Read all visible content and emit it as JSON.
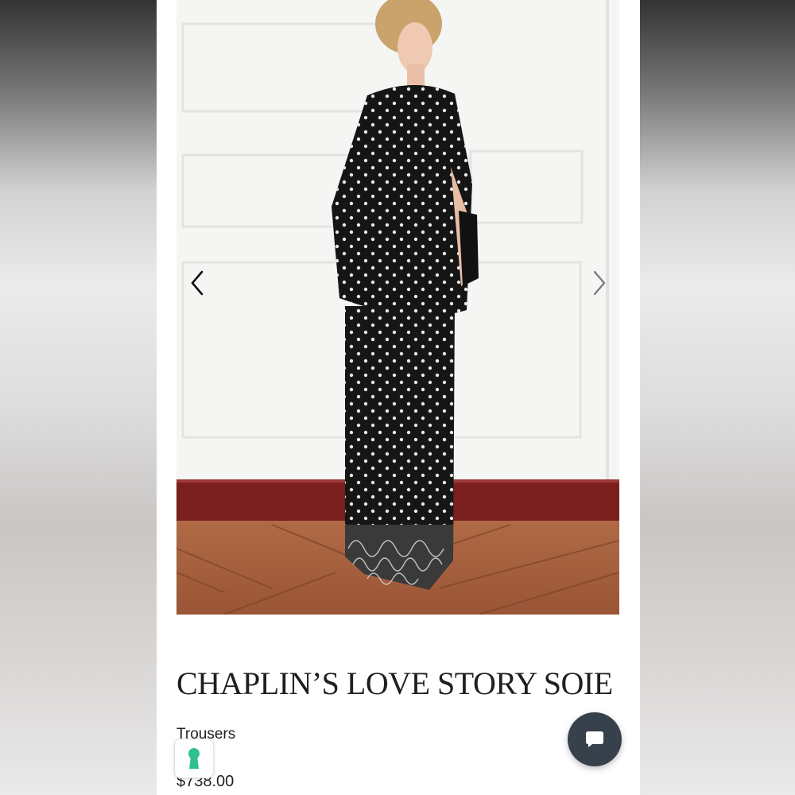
{
  "product": {
    "title": "CHAPLIN’S LOVE STORY SOIE",
    "category": "Trousers",
    "price": "$738.00"
  },
  "gallery": {
    "prev_icon": "chevron-left-icon",
    "next_icon": "chevron-right-icon"
  },
  "widgets": {
    "keyhole_icon": "keyhole-icon",
    "chat_icon": "chat-bubble-icon"
  },
  "colors": {
    "chat_button": "#37414c",
    "keyhole": "#2fc08f",
    "baseboard": "#7b1e1e"
  }
}
